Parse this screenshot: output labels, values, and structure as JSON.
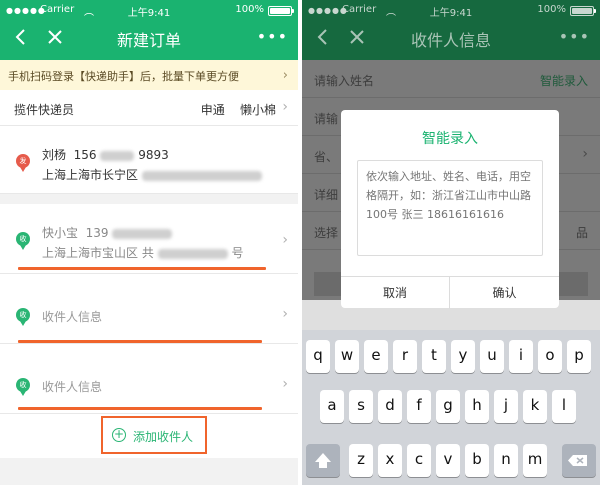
{
  "status_bar": {
    "carrier": "Carrier",
    "time": "上午9:41",
    "battery": "100%"
  },
  "left": {
    "nav": {
      "title": "新建订单",
      "more": "•••"
    },
    "banner": {
      "text": "手机扫码登录【快递助手】后，批量下单更方便"
    },
    "courier": {
      "label": "揽件快递员",
      "company": "申通",
      "name": "懒小棉"
    },
    "sender": {
      "badge": "发",
      "name": "刘杨",
      "phone_start": "156",
      "phone_end": "9893",
      "address": "上海上海市长宁区"
    },
    "receivers": [
      {
        "badge": "收",
        "name": "快小宝",
        "phone_start": "139",
        "address_start": "上海上海市宝山区",
        "address_mid": "共",
        "address_end": "号"
      },
      {
        "badge": "收",
        "placeholder": "收件人信息"
      },
      {
        "badge": "收",
        "placeholder": "收件人信息"
      }
    ],
    "add_receiver": {
      "label": "添加收件人"
    }
  },
  "right": {
    "nav": {
      "title": "收件人信息",
      "more": "•••"
    },
    "bg_form": {
      "name_placeholder": "请输入姓名",
      "smart_link": "智能录入",
      "row2": "请输",
      "row3": "省、",
      "row4": "详细",
      "row5_left": "选择",
      "row5_right": "品"
    },
    "modal": {
      "title": "智能录入",
      "placeholder": "依次输入地址、姓名、电话，用空格隔开，如：浙江省江山市中山路100号 张三 18616161616",
      "cancel": "取消",
      "confirm": "确认"
    },
    "keyboard": {
      "row1": [
        "q",
        "w",
        "e",
        "r",
        "t",
        "y",
        "u",
        "i",
        "o",
        "p"
      ],
      "row2": [
        "a",
        "s",
        "d",
        "f",
        "g",
        "h",
        "j",
        "k",
        "l"
      ],
      "row3": [
        "z",
        "x",
        "c",
        "v",
        "b",
        "n",
        "m"
      ]
    }
  }
}
